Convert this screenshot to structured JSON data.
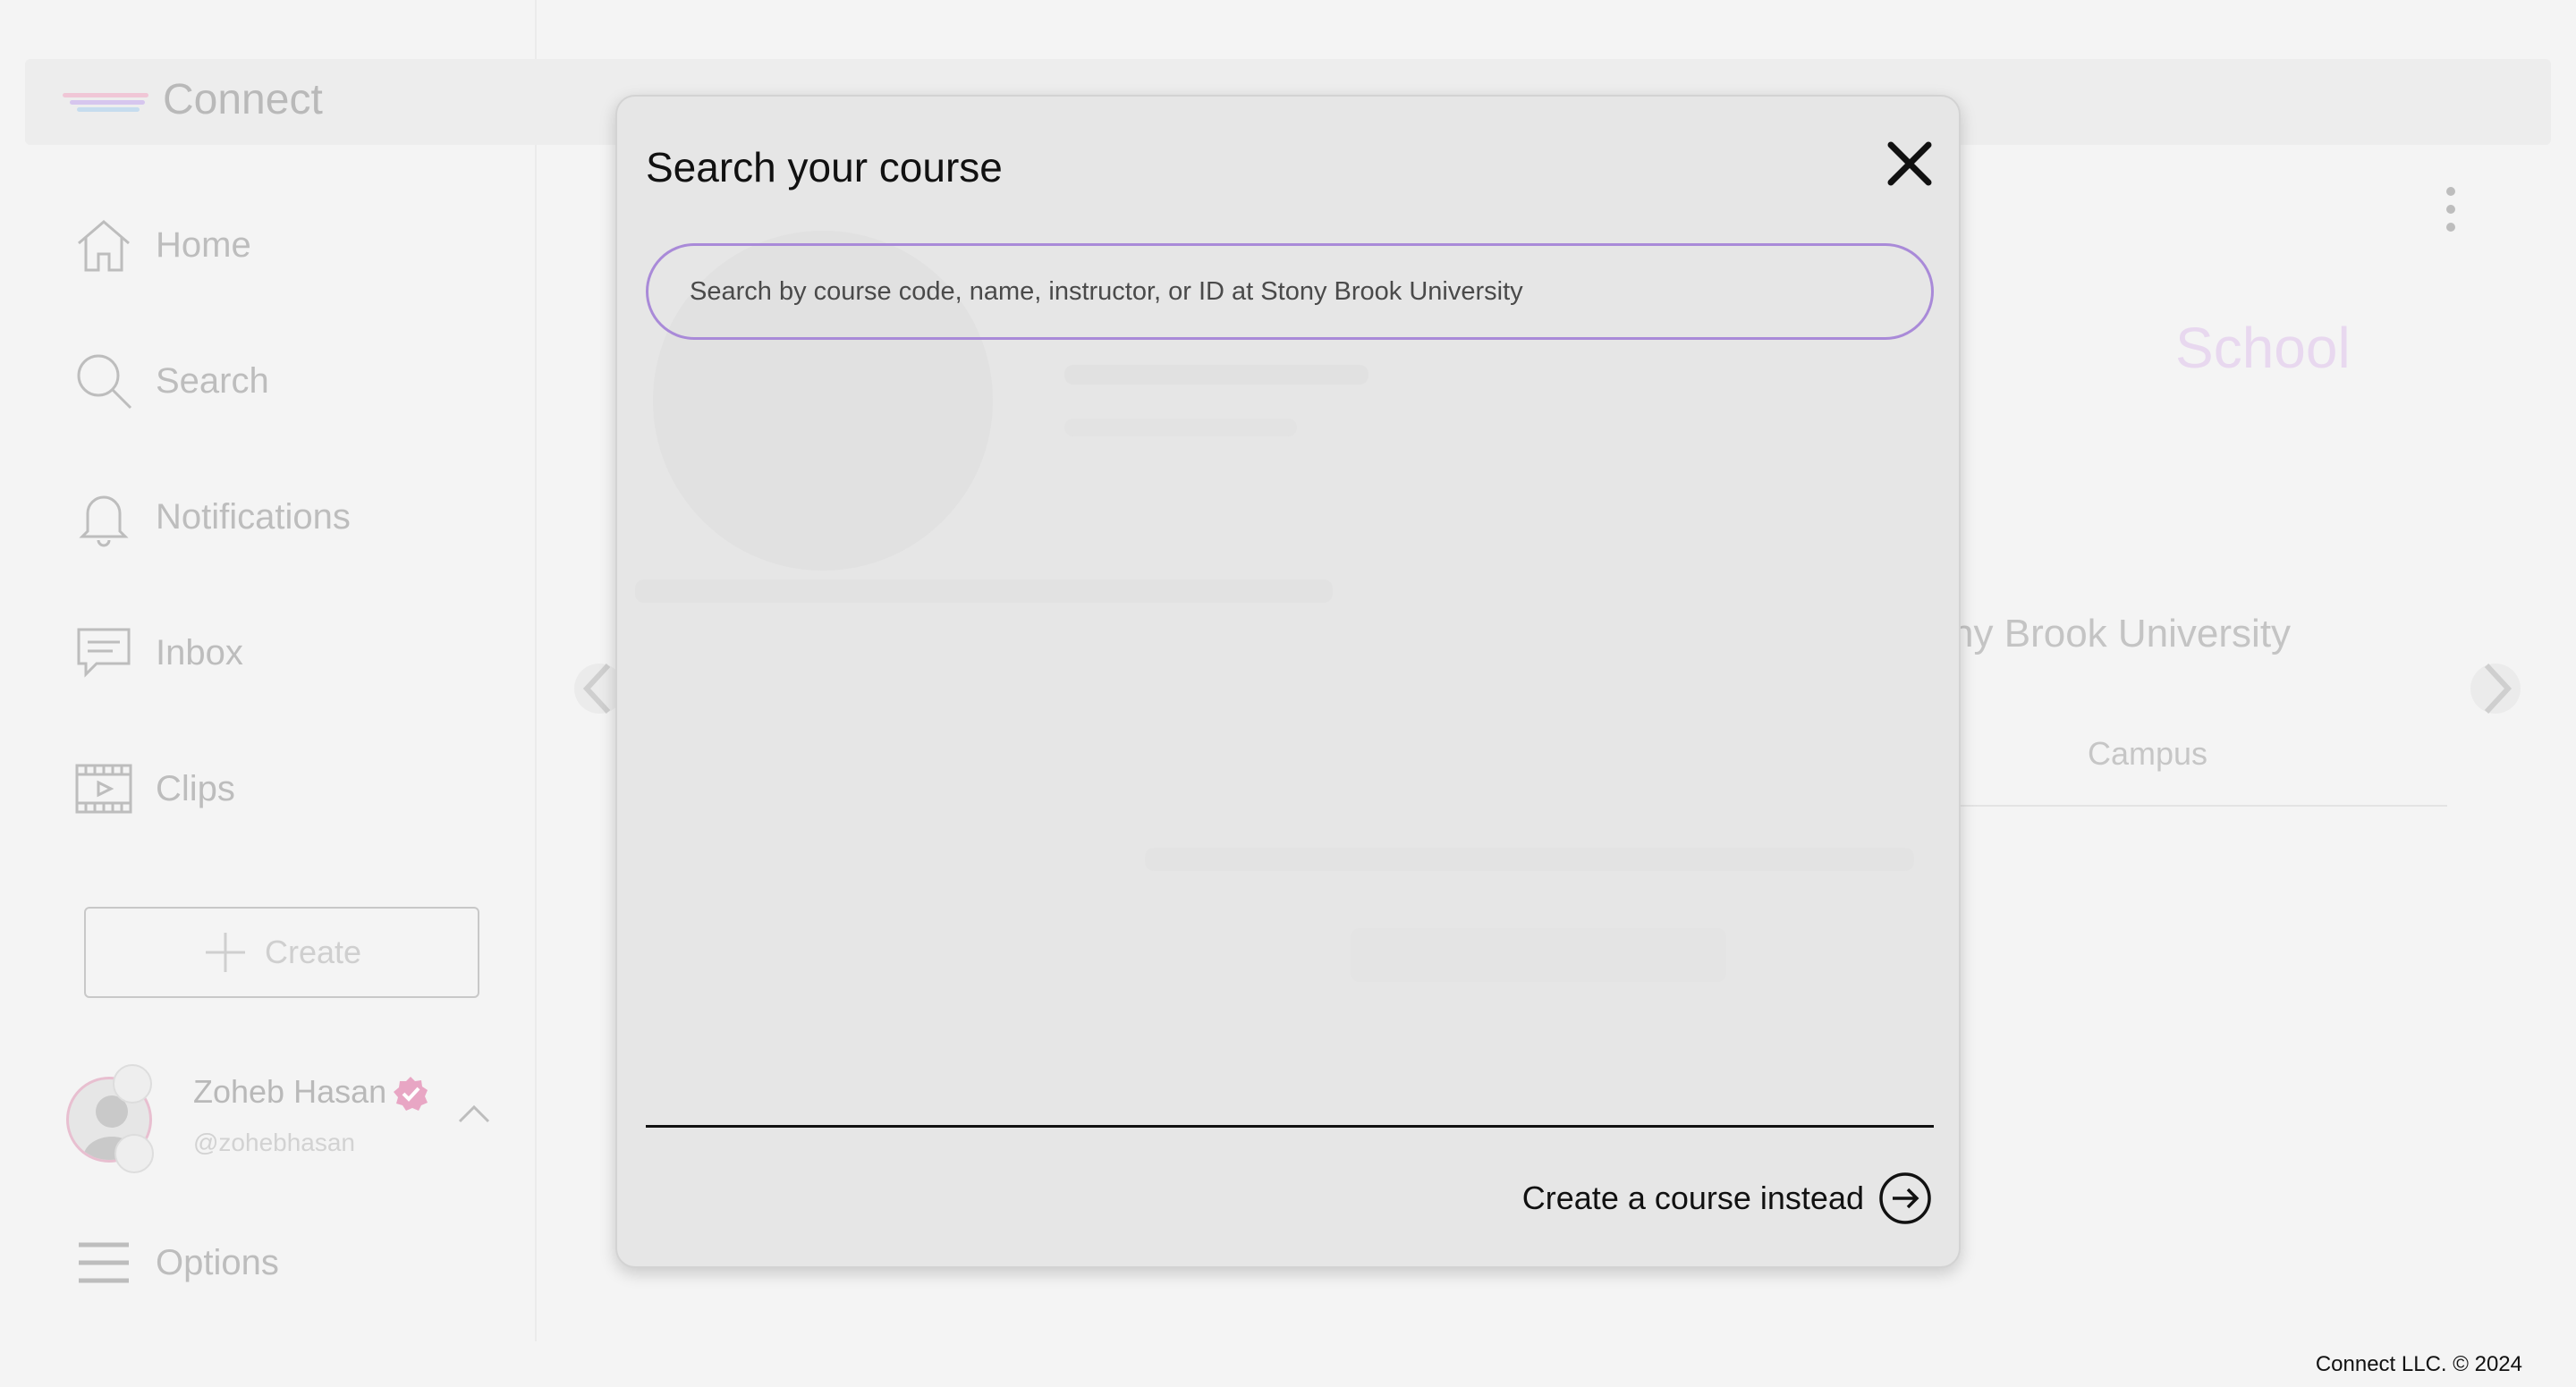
{
  "app": {
    "logo_text": "Connect"
  },
  "sidebar": {
    "items": [
      {
        "label": "Home",
        "icon": "home-icon"
      },
      {
        "label": "Search",
        "icon": "search-icon"
      },
      {
        "label": "Notifications",
        "icon": "bell-icon"
      },
      {
        "label": "Inbox",
        "icon": "inbox-icon"
      },
      {
        "label": "Clips",
        "icon": "film-icon"
      }
    ],
    "create_label": "Create",
    "profile": {
      "name": "Zoheb Hasan",
      "handle": "@zohebhasan"
    },
    "options_label": "Options"
  },
  "background": {
    "school_label": "School",
    "university": "Stony Brook University",
    "tab_campus": "Campus"
  },
  "modal": {
    "title": "Search your course",
    "search_placeholder": "Search by course code, name, instructor, or ID at Stony Brook University",
    "create_instead_label": "Create a course instead"
  },
  "footer": {
    "copyright": "Connect LLC. © 2024"
  },
  "colors": {
    "accent_purple": "#a98ad8",
    "verified_pink": "#e8a6c4"
  }
}
